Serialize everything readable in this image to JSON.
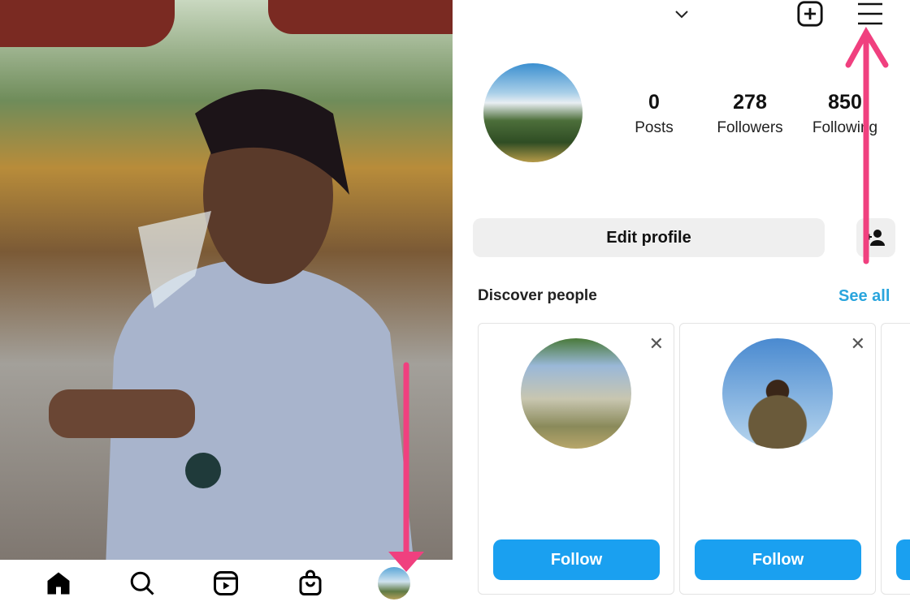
{
  "bottom_nav": {
    "items": [
      {
        "name": "home"
      },
      {
        "name": "search"
      },
      {
        "name": "reels"
      },
      {
        "name": "shop"
      },
      {
        "name": "profile"
      }
    ]
  },
  "profile": {
    "stats": [
      {
        "value": "0",
        "label": "Posts"
      },
      {
        "value": "278",
        "label": "Followers"
      },
      {
        "value": "850",
        "label": "Following"
      }
    ],
    "edit_profile_label": "Edit profile"
  },
  "discover": {
    "title": "Discover people",
    "see_all": "See all",
    "cards": [
      {
        "follow_label": "Follow",
        "close": "✕"
      },
      {
        "follow_label": "Follow",
        "close": "✕"
      }
    ]
  },
  "colors": {
    "accent": "#1aa0f0",
    "link": "#2aa5dd",
    "arrow": "#f0407f"
  }
}
